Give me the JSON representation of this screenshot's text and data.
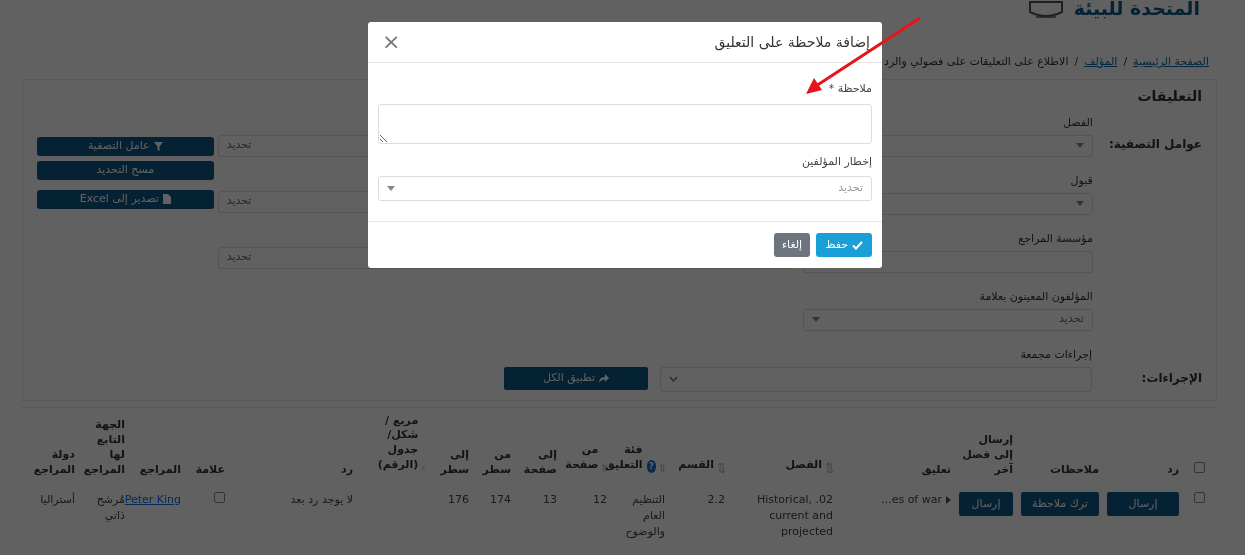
{
  "header": {
    "title": "المتحدة للبيئة"
  },
  "breadcrumb": [
    {
      "label": "الصفحة الرئيسية",
      "current": false
    },
    {
      "label": "المؤلف",
      "current": false
    },
    {
      "label": "الاطلاع على التعليقات على فصولي والرد",
      "current": true
    }
  ],
  "breadcrumb_separator": "/",
  "card": {
    "title": "التعليقات",
    "filters_label": "عوامل التصفية:",
    "fields": [
      {
        "label": "الفصل",
        "kind": "select"
      },
      {
        "label": "قبول",
        "kind": "select"
      },
      {
        "label": "مؤسسة المراجع",
        "kind": "input"
      },
      {
        "label": "المؤلفون المعينون بعلامة",
        "kind": "select",
        "placeholder": "تحديد"
      }
    ],
    "side_fields": [
      {
        "placeholder": "تحديد"
      },
      {
        "placeholder": "تحديد"
      },
      {
        "placeholder": "تحديد"
      }
    ],
    "buttons": [
      {
        "label": "عامل التصفية"
      },
      {
        "label": "مسح التحديد"
      },
      {
        "label": "تصدير إلى Excel"
      }
    ],
    "actions_label": "الإجراءات:",
    "bulk_label": "إجراءات مجمعة",
    "apply_button": "تطبيق الكل"
  },
  "table": {
    "columns": [
      {
        "kind": "checkbox",
        "checked": false
      },
      {
        "label": "رد",
        "sortable": false
      },
      {
        "label": "ملاحظات",
        "sortable": false
      },
      {
        "label": "إرسال إلى فصل آخر",
        "sortable": false
      },
      {
        "label": "تعليق",
        "sortable": false
      },
      {
        "label": "الفصل",
        "sortable": true
      },
      {
        "label": "القسم",
        "sortable": true
      },
      {
        "label": "فئة التعليق",
        "sortable": true,
        "help": "?"
      },
      {
        "label": "من صفحة",
        "sortable": true
      },
      {
        "label": "إلى صفحة",
        "sortable": false
      },
      {
        "label": "من سطر",
        "sortable": false
      },
      {
        "label": "إلى سطر",
        "sortable": false
      },
      {
        "label": "مربع / شكل/ جدول (الرقم)",
        "sortable": true
      },
      {
        "label": "رد",
        "sortable": false
      },
      {
        "label": "علامة",
        "sortable": false
      },
      {
        "label": "المراجع",
        "sortable": false
      },
      {
        "label": "الجهة التابع لها المراجع",
        "sortable": false
      },
      {
        "label": "دولة المراجع",
        "sortable": false
      }
    ],
    "rows": [
      [
        {
          "kind": "checkbox",
          "checked": false
        },
        {
          "kind": "button",
          "text": "إرسال"
        },
        {
          "kind": "button",
          "text": "ترك ملاحظة"
        },
        {
          "kind": "button",
          "text": "إرسال"
        },
        {
          "kind": "comment",
          "text": "...es of war"
        },
        {
          "kind": "text",
          "text": "02. Historical, current and projected"
        },
        {
          "kind": "text",
          "text": "2.2"
        },
        {
          "kind": "text",
          "text": "التنظيم العام والوضوح"
        },
        {
          "kind": "text",
          "text": "12"
        },
        {
          "kind": "text",
          "text": "13"
        },
        {
          "kind": "text",
          "text": "174"
        },
        {
          "kind": "text",
          "text": "176"
        },
        {
          "kind": "text",
          "text": ""
        },
        {
          "kind": "text",
          "text": "لا يوجد رد بعد"
        },
        {
          "kind": "checkbox",
          "checked": false
        },
        {
          "kind": "link",
          "text": "Peter King"
        },
        {
          "kind": "text",
          "text": "مُرشح ذاتي"
        },
        {
          "kind": "text",
          "text": "أستراليا"
        }
      ]
    ]
  },
  "modal": {
    "title": "إضافة ملاحظة على التعليق",
    "close": "×",
    "fields": [
      {
        "label": "ملاحظة",
        "required": true,
        "kind": "textarea"
      },
      {
        "label": "إخطار المؤلفين",
        "required": false,
        "kind": "select",
        "placeholder": "تحديد"
      }
    ],
    "required_mark": "*",
    "buttons": [
      {
        "label": "حفظ",
        "kind": "save"
      },
      {
        "label": "إلغاء",
        "kind": "cancel"
      }
    ]
  }
}
